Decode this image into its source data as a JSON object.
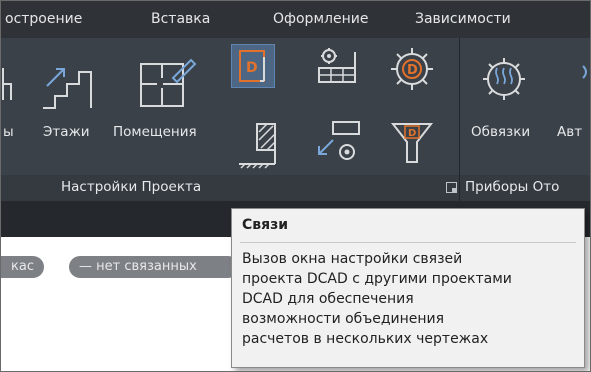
{
  "tabs": [
    {
      "label": "остроение"
    },
    {
      "label": "Вставка"
    },
    {
      "label": "Оформление"
    },
    {
      "label": "Зависимости"
    }
  ],
  "ribbon": {
    "buttons": {
      "partial_left": "ы",
      "floors": "Этажи",
      "rooms": "Помещения",
      "bindings": "Обвязки",
      "auto_partial": "Авт"
    },
    "panels": {
      "project_settings": "Настройки Проекта",
      "heating_devices_partial": "Приборы Ото"
    }
  },
  "pills": {
    "left": "кас",
    "right": "— нет связанных"
  },
  "tooltip": {
    "title": "Связи",
    "lines": [
      "Вызов окна настройки связей",
      "проекта DCAD с другими проектами",
      "DCAD для обеспечения",
      "возможности объединения",
      "расчетов в нескольких чертежах"
    ]
  },
  "colors": {
    "accent_orange": "#e2722b",
    "ribbon_bg": "#3b4148",
    "selected_bg": "#4d6683"
  }
}
